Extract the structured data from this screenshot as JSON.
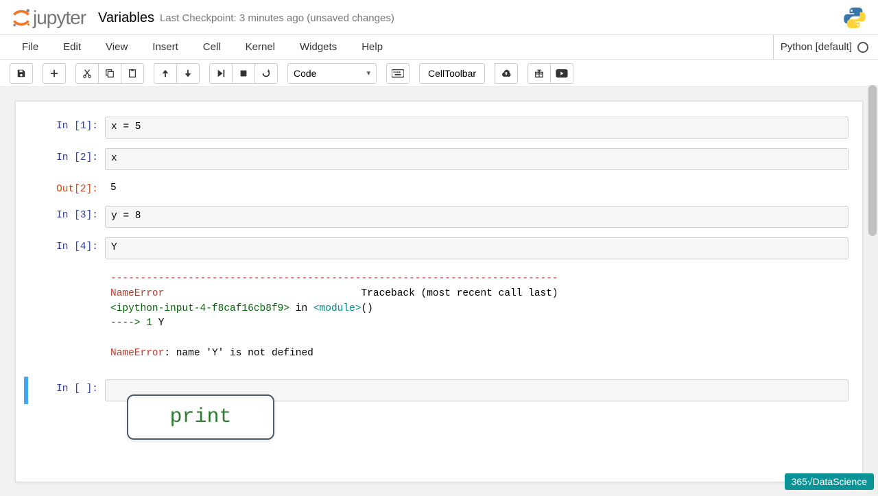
{
  "header": {
    "logo_text": "jupyter",
    "notebook_name": "Variables",
    "checkpoint": "Last Checkpoint: 3 minutes ago (unsaved changes)"
  },
  "menubar": {
    "items": [
      "File",
      "Edit",
      "View",
      "Insert",
      "Cell",
      "Kernel",
      "Widgets",
      "Help"
    ],
    "kernel_name": "Python [default]"
  },
  "toolbar": {
    "cell_type": "Code",
    "celltoolbar_label": "CellToolbar"
  },
  "cells": [
    {
      "type": "in",
      "n": "1",
      "src": "x = 5"
    },
    {
      "type": "in",
      "n": "2",
      "src": "x"
    },
    {
      "type": "out",
      "n": "2",
      "text": "5"
    },
    {
      "type": "in",
      "n": "3",
      "src": "y = 8"
    },
    {
      "type": "in",
      "n": "4",
      "src": "Y"
    }
  ],
  "traceback": {
    "sep": "---------------------------------------------------------------------------",
    "err_name": "NameError",
    "tb_header": "Traceback (most recent call last)",
    "loc_pre": "<ipython-input-4-f8caf16cb8f9>",
    "loc_mid": " in ",
    "loc_mod": "<module>",
    "loc_post": "()",
    "arrow": "----> 1 ",
    "arrow_code": "Y",
    "final_pre": "NameError",
    "final_post": ": name 'Y' is not defined"
  },
  "empty_cell_prompt": "In [ ]:",
  "overlay": {
    "text": "print"
  },
  "watermark": "365√DataScience"
}
